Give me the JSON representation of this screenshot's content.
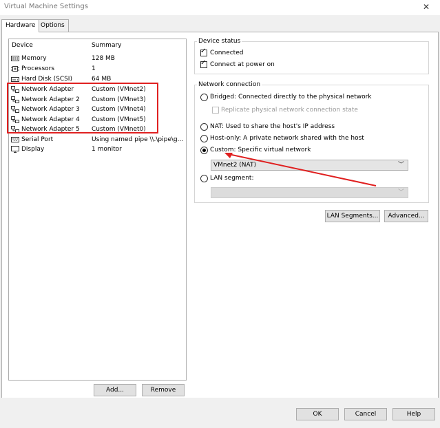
{
  "window": {
    "title": "Virtual Machine Settings",
    "close_glyph": "✕"
  },
  "tabs": [
    {
      "label": "Hardware"
    },
    {
      "label": "Options"
    }
  ],
  "device_list": {
    "col_device": "Device",
    "col_summary": "Summary",
    "rows": [
      {
        "device": "Memory",
        "summary": "128 MB",
        "icon": "memory-icon"
      },
      {
        "device": "Processors",
        "summary": "1",
        "icon": "processor-icon"
      },
      {
        "device": "Hard Disk (SCSI)",
        "summary": "64 MB",
        "icon": "hard-disk-icon"
      },
      {
        "device": "Network Adapter",
        "summary": "Custom (VMnet2)",
        "icon": "network-adapter-icon"
      },
      {
        "device": "Network Adapter 2",
        "summary": "Custom (VMnet3)",
        "icon": "network-adapter-icon"
      },
      {
        "device": "Network Adapter 3",
        "summary": "Custom (VMnet4)",
        "icon": "network-adapter-icon"
      },
      {
        "device": "Network Adapter 4",
        "summary": "Custom (VMnet5)",
        "icon": "network-adapter-icon"
      },
      {
        "device": "Network Adapter 5",
        "summary": "Custom (VMnet0)",
        "icon": "network-adapter-icon"
      },
      {
        "device": "Serial Port",
        "summary": "Using named pipe \\\\.\\pipe\\g...",
        "icon": "serial-port-icon"
      },
      {
        "device": "Display",
        "summary": "1 monitor",
        "icon": "display-icon"
      }
    ],
    "add_label": "Add...",
    "remove_label": "Remove"
  },
  "device_status": {
    "title": "Device status",
    "connected_label": "Connected",
    "connected_checked": true,
    "power_on_label": "Connect at power on",
    "power_on_checked": true
  },
  "network_connection": {
    "title": "Network connection",
    "bridged_label": "Bridged: Connected directly to the physical network",
    "replicate_label": "Replicate physical network connection state",
    "nat_label": "NAT: Used to share the host's IP address",
    "host_only_label": "Host-only: A private network shared with the host",
    "custom_label": "Custom: Specific virtual network",
    "custom_value": "VMnet2 (NAT)",
    "lan_segment_label": "LAN segment:",
    "lan_segment_value": "",
    "selected": "custom"
  },
  "buttons": {
    "lan_segments": "LAN Segments...",
    "advanced": "Advanced...",
    "ok": "OK",
    "cancel": "Cancel",
    "help": "Help"
  },
  "colors": {
    "highlight": "#e02020"
  }
}
